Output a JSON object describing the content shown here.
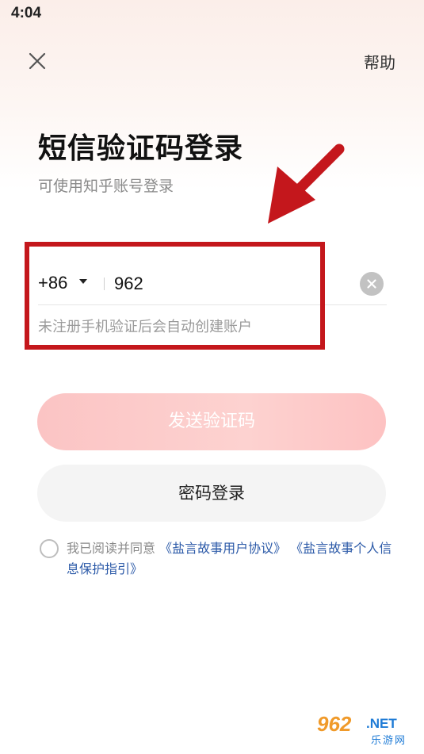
{
  "status_bar": {
    "time": "4:04"
  },
  "header": {
    "close_icon": "close-icon",
    "help_label": "帮助"
  },
  "login": {
    "title": "短信验证码登录",
    "subtitle": "可使用知乎账号登录",
    "country_code": "+86",
    "phone_value": "962",
    "hint": "未注册手机验证后会自动创建账户",
    "send_code_label": "发送验证码",
    "password_login_label": "密码登录"
  },
  "agreement": {
    "prefix": "我已阅读并同意 ",
    "link_user": "《盐言故事用户协议》",
    "link_privacy": "《盐言故事个人信息保护指引》"
  },
  "annotation": {
    "box_color": "#c4171c",
    "arrow_color": "#c4171c"
  },
  "watermark": {
    "number": "962",
    "domain": ".NET",
    "chinese": "乐游网"
  },
  "colors": {
    "send_button": "#fdc8c6",
    "link": "#2c5aa8",
    "hint": "#9a9a9a"
  }
}
